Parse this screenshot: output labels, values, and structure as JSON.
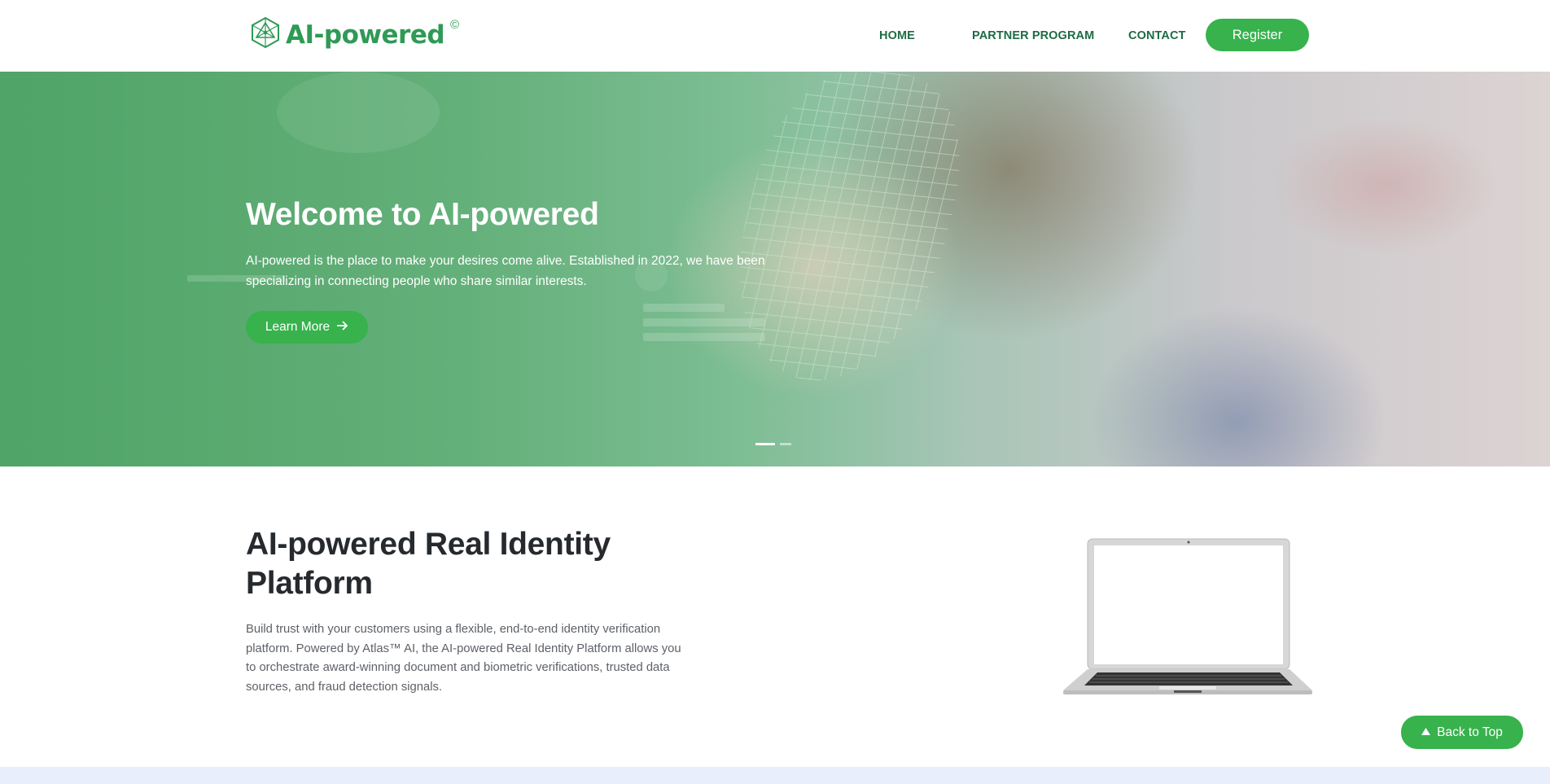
{
  "header": {
    "logo_text": "AI-powered",
    "logo_mark": "©",
    "nav": {
      "home": "HOME",
      "partner": "PARTNER PROGRAM",
      "contact": "CONTACT"
    },
    "register_label": "Register"
  },
  "hero": {
    "title": "Welcome to AI-powered",
    "text": "AI-powered is the place to make your desires come alive. Established in 2022, we have been specializing in connecting people who share similar interests.",
    "button_label": "Learn More",
    "button_icon": "arrow-right-icon",
    "slides_total": 2,
    "active_slide": 1
  },
  "section": {
    "title": "AI-powered Real Identity Platform",
    "text": "Build trust with your customers using a flexible, end-to-end identity verification platform. Powered by Atlas™ AI, the AI-powered Real Identity Platform allows you to orchestrate award-winning document and biometric verifications, trusted data sources, and fraud detection signals."
  },
  "back_to_top": {
    "label": "Back to Top",
    "icon": "triangle-up-icon"
  },
  "colors": {
    "accent": "#37b24d",
    "brand_dark": "#1e6b44",
    "logo": "#2f9a56",
    "band": "#e9eefc"
  }
}
